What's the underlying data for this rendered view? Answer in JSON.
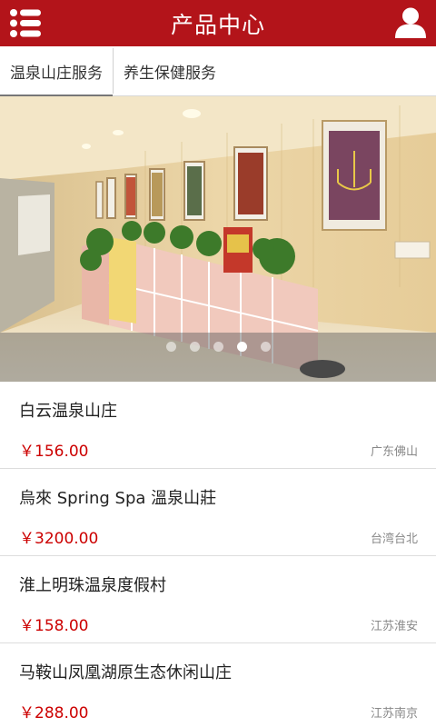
{
  "header": {
    "title": "产品中心",
    "menu_icon": "list-icon",
    "user_icon": "user-icon",
    "bg_color": "#b3141a"
  },
  "tabs": [
    {
      "label": "温泉山庄服务",
      "active": true
    },
    {
      "label": "养生保健服务",
      "active": false
    }
  ],
  "carousel": {
    "slide_count": 5,
    "active_index": 3
  },
  "products": [
    {
      "name": "白云温泉山庄",
      "price": "￥156.00",
      "location": "广东佛山"
    },
    {
      "name": "烏來 Spring Spa 溫泉山莊",
      "price": "￥3200.00",
      "location": "台湾台北"
    },
    {
      "name": "淮上明珠温泉度假村",
      "price": "￥158.00",
      "location": "江苏淮安"
    },
    {
      "name": "马鞍山凤凰湖原生态休闲山庄",
      "price": "￥288.00",
      "location": "江苏南京"
    }
  ],
  "colors": {
    "price": "#cc0000",
    "accent": "#b3141a"
  }
}
